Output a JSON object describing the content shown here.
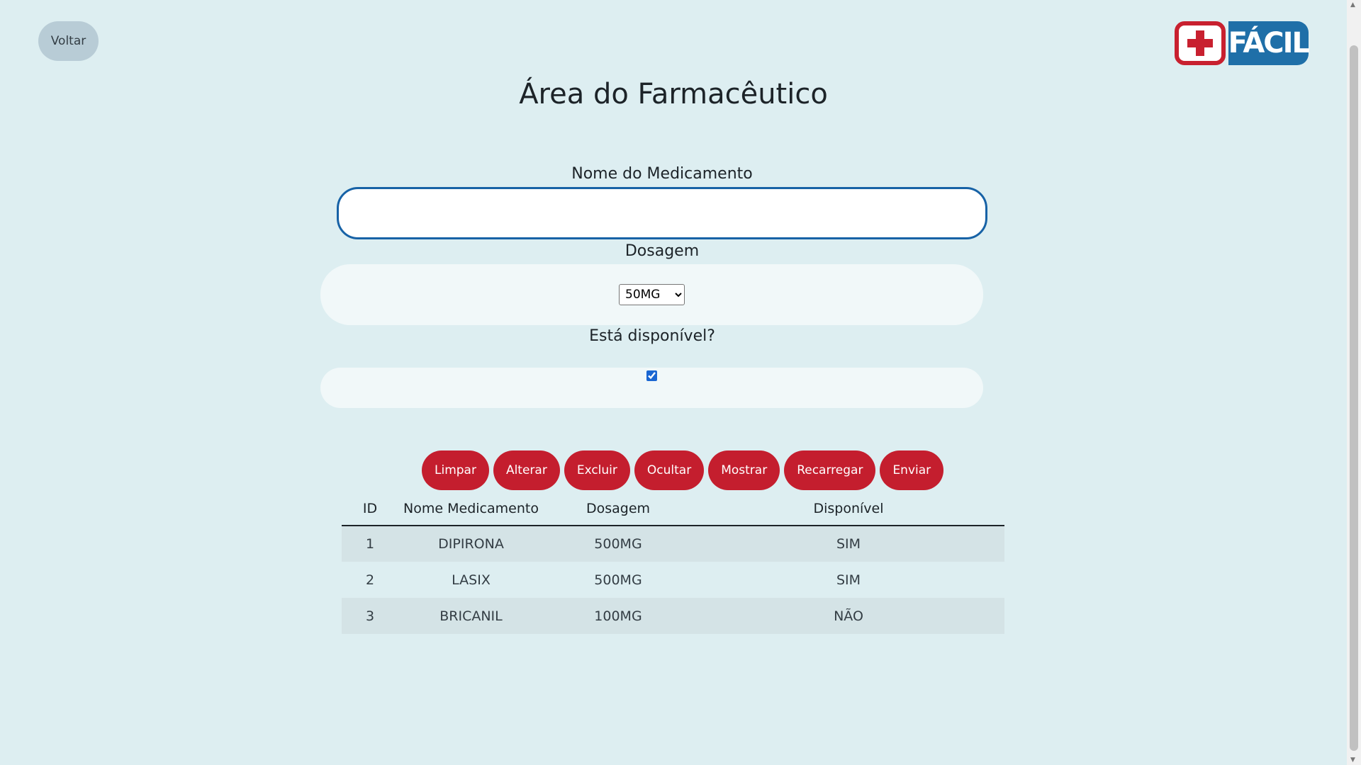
{
  "nav": {
    "back_label": "Voltar"
  },
  "logo": {
    "text": "FÁCIL"
  },
  "page": {
    "title": "Área do Farmacêutico"
  },
  "form": {
    "name_label": "Nome do Medicamento",
    "name_value": "",
    "dose_label": "Dosagem",
    "dose_selected": "50MG",
    "available_label": "Está disponível?",
    "available_checked": true
  },
  "actions": {
    "clear": "Limpar",
    "edit": "Alterar",
    "delete": "Excluir",
    "hide": "Ocultar",
    "show": "Mostrar",
    "reload": "Recarregar",
    "send": "Enviar"
  },
  "table": {
    "headers": [
      "ID",
      "Nome Medicamento",
      "Dosagem",
      "Disponível"
    ],
    "rows": [
      [
        "1",
        "DIPIRONA",
        "500MG",
        "SIM"
      ],
      [
        "2",
        "LASIX",
        "500MG",
        "SIM"
      ],
      [
        "3",
        "BRICANIL",
        "100MG",
        "NÃO"
      ]
    ]
  },
  "colors": {
    "accent_red": "#c41e2e",
    "brand_blue": "#1f6fa8",
    "background": "#ddeef1"
  }
}
